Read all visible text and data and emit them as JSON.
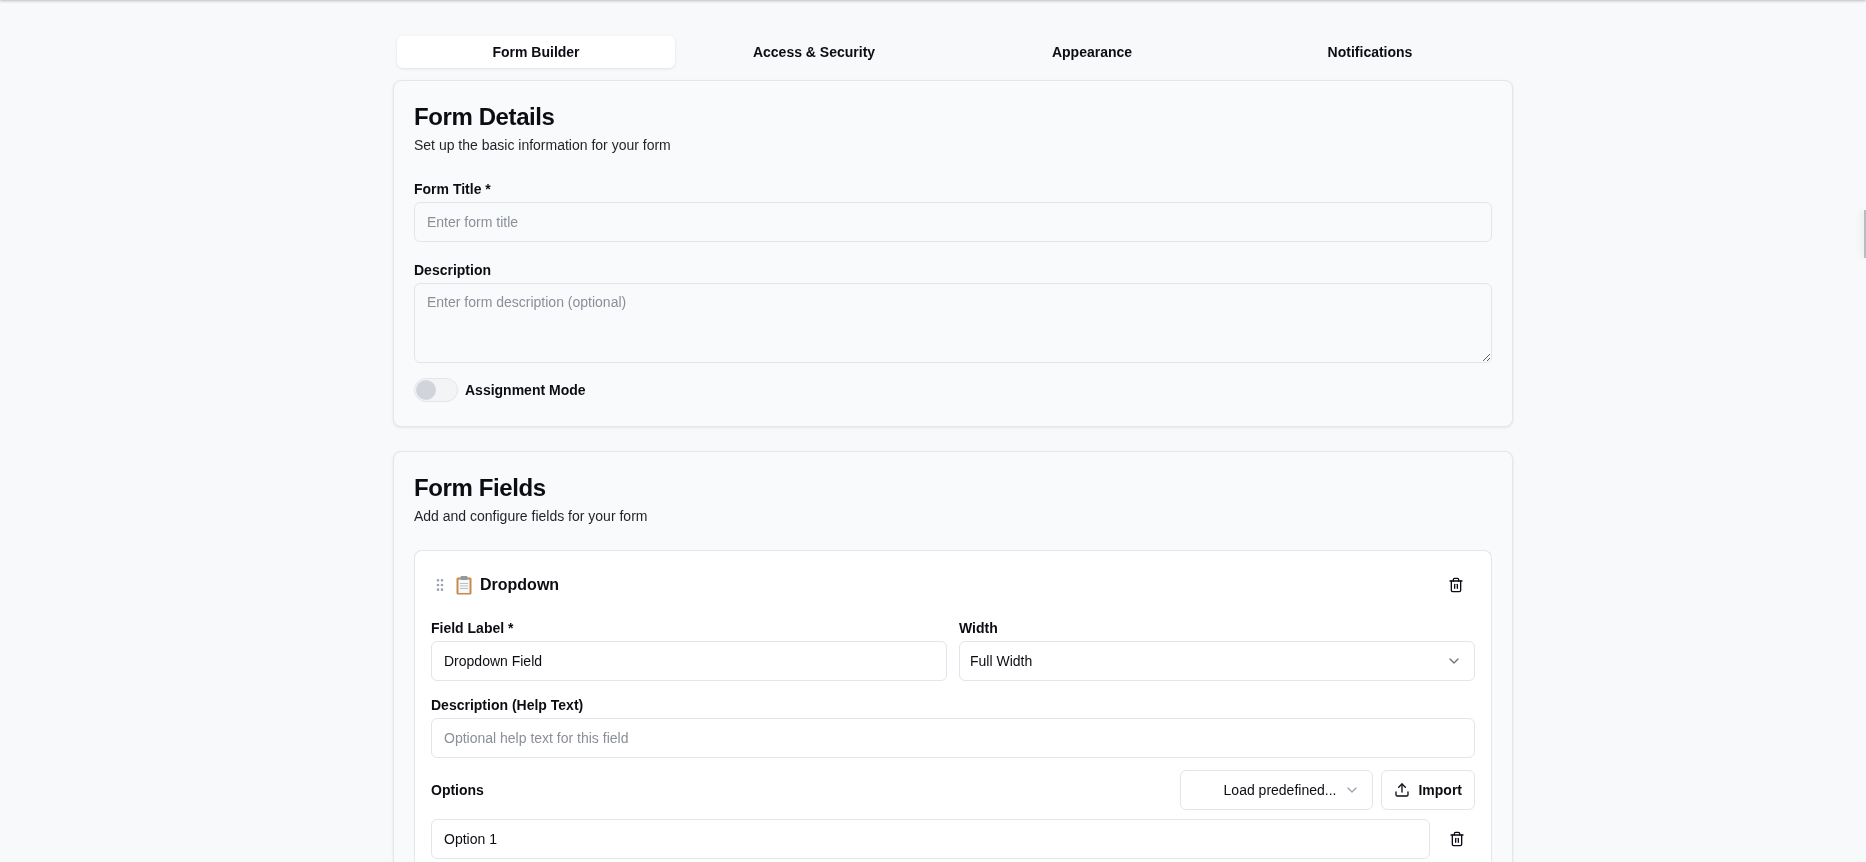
{
  "tabs": [
    {
      "label": "Form Builder",
      "selected": true
    },
    {
      "label": "Access & Security",
      "selected": false
    },
    {
      "label": "Appearance",
      "selected": false
    },
    {
      "label": "Notifications",
      "selected": false
    }
  ],
  "form_details": {
    "title": "Form Details",
    "subtitle": "Set up the basic information for your form",
    "fields": [
      {
        "kind": "input",
        "label": "Form Title *",
        "placeholder": "Enter form title"
      },
      {
        "kind": "textarea",
        "label": "Description",
        "placeholder": "Enter form description (optional)"
      }
    ],
    "assignment_mode": {
      "label": "Assignment Mode",
      "on": false
    }
  },
  "form_fields": {
    "title": "Form Fields",
    "subtitle": "Add and configure fields for your form",
    "fields": [
      {
        "title": "Dropdown",
        "label_field": {
          "label": "Field Label *",
          "value": "Dropdown Field"
        },
        "width_field": {
          "label": "Width",
          "value": "Full Width"
        },
        "help_field": {
          "label": "Description (Help Text)",
          "placeholder": "Optional help text for this field"
        },
        "options": {
          "label": "Options",
          "preset_button": "Load predefined...",
          "import_button": "Import",
          "items": [
            {
              "value": "Option 1"
            }
          ]
        }
      }
    ]
  }
}
